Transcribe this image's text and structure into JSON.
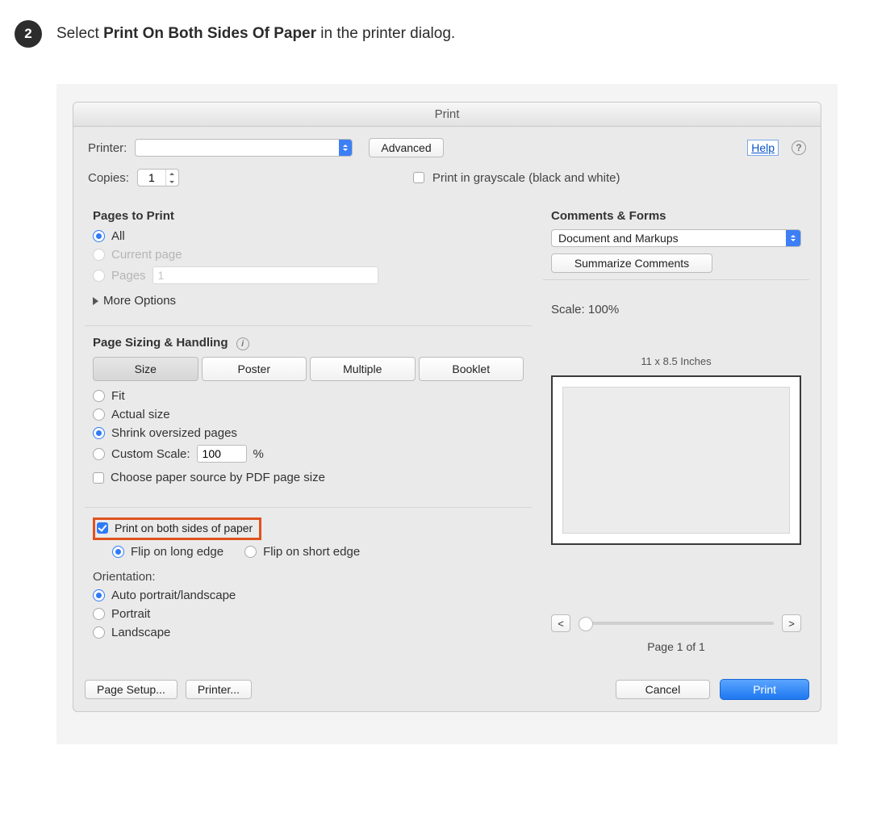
{
  "step": {
    "number": "2",
    "prefix": "Select ",
    "bold": "Print On Both Sides Of Paper",
    "suffix": " in the printer dialog."
  },
  "dialog": {
    "title": "Print",
    "printer_label": "Printer:",
    "printer_value": "",
    "advanced": "Advanced",
    "help": "Help",
    "copies_label": "Copies:",
    "copies_value": "1",
    "grayscale": "Print in grayscale (black and white)"
  },
  "pages": {
    "title": "Pages to Print",
    "all": "All",
    "current": "Current page",
    "pages": "Pages",
    "pages_value": "1",
    "more": "More Options"
  },
  "sizing": {
    "title": "Page Sizing & Handling",
    "tabs": {
      "size": "Size",
      "poster": "Poster",
      "multiple": "Multiple",
      "booklet": "Booklet"
    },
    "fit": "Fit",
    "actual": "Actual size",
    "shrink": "Shrink oversized pages",
    "custom": "Custom Scale:",
    "custom_value": "100",
    "custom_unit": "%",
    "choose_source": "Choose paper source by PDF page size"
  },
  "both": {
    "label": "Print on both sides of paper",
    "long": "Flip on long edge",
    "short": "Flip on short edge"
  },
  "orientation": {
    "title": "Orientation:",
    "auto": "Auto portrait/landscape",
    "portrait": "Portrait",
    "landscape": "Landscape"
  },
  "comments": {
    "title": "Comments & Forms",
    "value": "Document and Markups",
    "summarize": "Summarize Comments"
  },
  "preview": {
    "scale": "Scale: 100%",
    "dims": "11 x 8.5 Inches",
    "prev": "<",
    "next": ">",
    "page": "Page 1 of 1"
  },
  "footer": {
    "page_setup": "Page Setup...",
    "printer": "Printer...",
    "cancel": "Cancel",
    "print": "Print"
  }
}
